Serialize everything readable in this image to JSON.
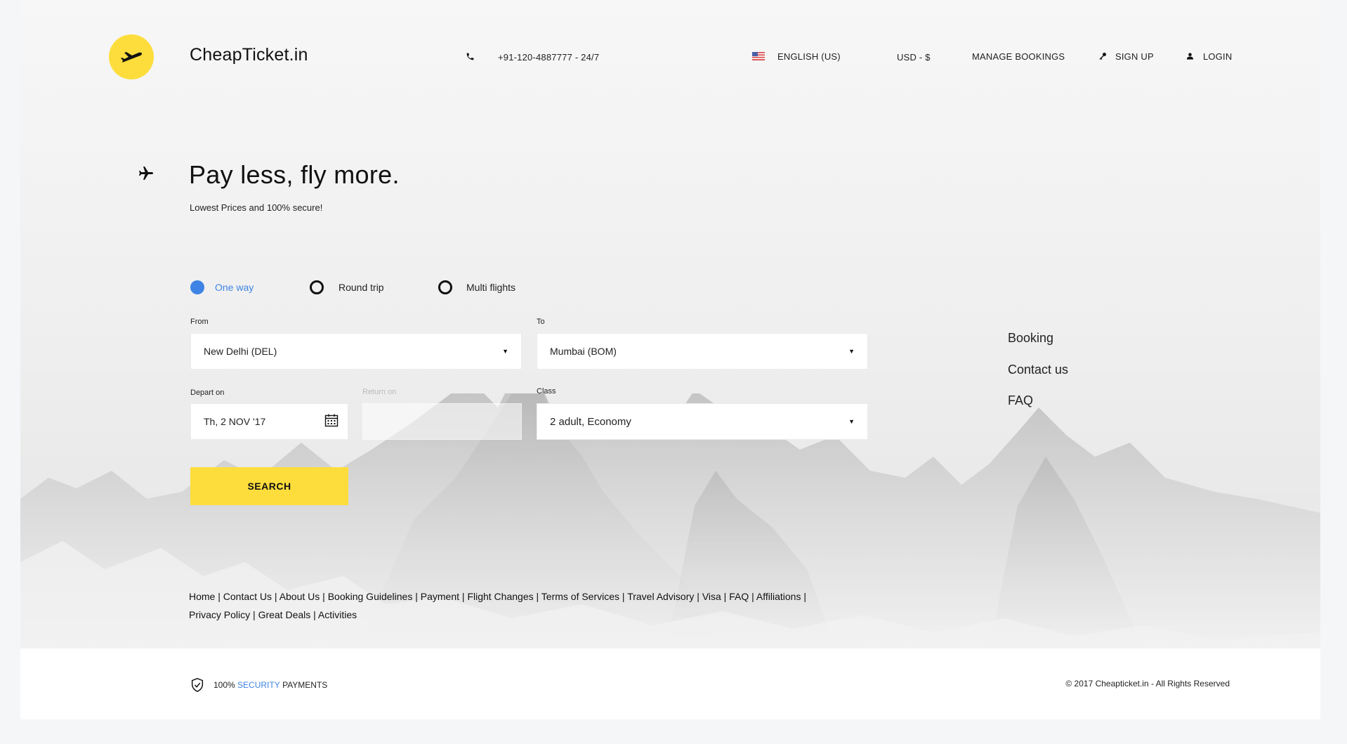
{
  "brand": {
    "name": "CheapTicket.in",
    "accent": "#fddd3c"
  },
  "header": {
    "phone": "+91-120-4887777  -  24/7",
    "language": "ENGLISH (US)",
    "currency": "USD - $",
    "manage_bookings": "MANAGE BOOKINGS",
    "sign_up": "SIGN UP",
    "login": "LOGIN"
  },
  "hero": {
    "title": "Pay less, fly more.",
    "subtitle": "Lowest Prices and 100% secure!"
  },
  "trip_types": [
    {
      "label": "One way",
      "selected": true
    },
    {
      "label": "Round trip",
      "selected": false
    },
    {
      "label": "Multi flights",
      "selected": false
    }
  ],
  "form": {
    "from_label": "From",
    "from_value": "New Delhi  (DEL)",
    "to_label": "To",
    "to_value": "Mumbai  (BOM)",
    "depart_label": "Depart on",
    "depart_value": "Th, 2 NOV '17",
    "return_label": "Return on",
    "return_value": "",
    "class_label": "Class",
    "class_value": "2 adult, Economy",
    "search_label": "SEARCH"
  },
  "side_links": [
    "Booking",
    "Contact us",
    "FAQ"
  ],
  "footer_links": [
    "Home",
    "Contact Us",
    "About Us",
    "Booking Guidelines",
    "Payment",
    "Flight Changes",
    "Terms of Services",
    "Travel Advisory",
    "Visa",
    "FAQ",
    "Affiliations",
    "Privacy Policy",
    "Great Deals",
    "Activities"
  ],
  "footer": {
    "secure_prefix": "100% ",
    "secure_highlight": "SECURITY",
    "secure_suffix": " PAYMENTS",
    "copyright": "© 2017 Cheapticket.in - All Rights Reserved"
  },
  "colors": {
    "primary_blue": "#3f84e5",
    "accent_yellow": "#fddd3c"
  }
}
